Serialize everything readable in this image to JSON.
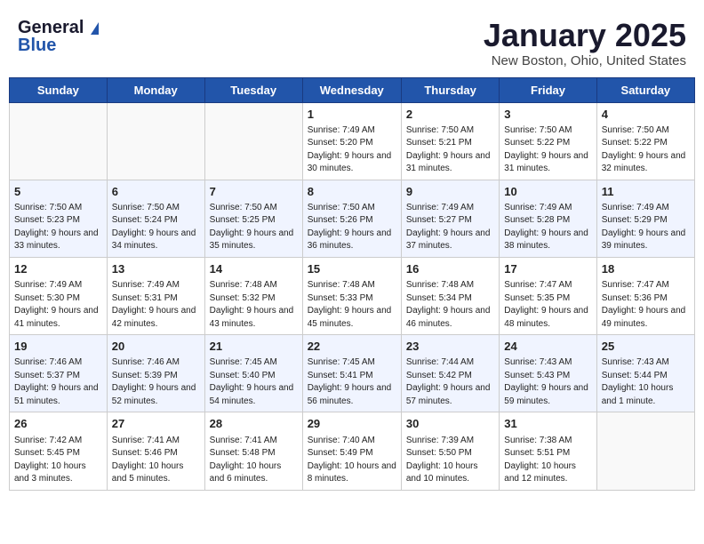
{
  "header": {
    "logo_line1": "General",
    "logo_line2": "Blue",
    "month": "January 2025",
    "location": "New Boston, Ohio, United States"
  },
  "weekdays": [
    "Sunday",
    "Monday",
    "Tuesday",
    "Wednesday",
    "Thursday",
    "Friday",
    "Saturday"
  ],
  "weeks": [
    [
      {
        "day": "",
        "sunrise": "",
        "sunset": "",
        "daylight": ""
      },
      {
        "day": "",
        "sunrise": "",
        "sunset": "",
        "daylight": ""
      },
      {
        "day": "",
        "sunrise": "",
        "sunset": "",
        "daylight": ""
      },
      {
        "day": "1",
        "sunrise": "Sunrise: 7:49 AM",
        "sunset": "Sunset: 5:20 PM",
        "daylight": "Daylight: 9 hours and 30 minutes."
      },
      {
        "day": "2",
        "sunrise": "Sunrise: 7:50 AM",
        "sunset": "Sunset: 5:21 PM",
        "daylight": "Daylight: 9 hours and 31 minutes."
      },
      {
        "day": "3",
        "sunrise": "Sunrise: 7:50 AM",
        "sunset": "Sunset: 5:22 PM",
        "daylight": "Daylight: 9 hours and 31 minutes."
      },
      {
        "day": "4",
        "sunrise": "Sunrise: 7:50 AM",
        "sunset": "Sunset: 5:22 PM",
        "daylight": "Daylight: 9 hours and 32 minutes."
      }
    ],
    [
      {
        "day": "5",
        "sunrise": "Sunrise: 7:50 AM",
        "sunset": "Sunset: 5:23 PM",
        "daylight": "Daylight: 9 hours and 33 minutes."
      },
      {
        "day": "6",
        "sunrise": "Sunrise: 7:50 AM",
        "sunset": "Sunset: 5:24 PM",
        "daylight": "Daylight: 9 hours and 34 minutes."
      },
      {
        "day": "7",
        "sunrise": "Sunrise: 7:50 AM",
        "sunset": "Sunset: 5:25 PM",
        "daylight": "Daylight: 9 hours and 35 minutes."
      },
      {
        "day": "8",
        "sunrise": "Sunrise: 7:50 AM",
        "sunset": "Sunset: 5:26 PM",
        "daylight": "Daylight: 9 hours and 36 minutes."
      },
      {
        "day": "9",
        "sunrise": "Sunrise: 7:49 AM",
        "sunset": "Sunset: 5:27 PM",
        "daylight": "Daylight: 9 hours and 37 minutes."
      },
      {
        "day": "10",
        "sunrise": "Sunrise: 7:49 AM",
        "sunset": "Sunset: 5:28 PM",
        "daylight": "Daylight: 9 hours and 38 minutes."
      },
      {
        "day": "11",
        "sunrise": "Sunrise: 7:49 AM",
        "sunset": "Sunset: 5:29 PM",
        "daylight": "Daylight: 9 hours and 39 minutes."
      }
    ],
    [
      {
        "day": "12",
        "sunrise": "Sunrise: 7:49 AM",
        "sunset": "Sunset: 5:30 PM",
        "daylight": "Daylight: 9 hours and 41 minutes."
      },
      {
        "day": "13",
        "sunrise": "Sunrise: 7:49 AM",
        "sunset": "Sunset: 5:31 PM",
        "daylight": "Daylight: 9 hours and 42 minutes."
      },
      {
        "day": "14",
        "sunrise": "Sunrise: 7:48 AM",
        "sunset": "Sunset: 5:32 PM",
        "daylight": "Daylight: 9 hours and 43 minutes."
      },
      {
        "day": "15",
        "sunrise": "Sunrise: 7:48 AM",
        "sunset": "Sunset: 5:33 PM",
        "daylight": "Daylight: 9 hours and 45 minutes."
      },
      {
        "day": "16",
        "sunrise": "Sunrise: 7:48 AM",
        "sunset": "Sunset: 5:34 PM",
        "daylight": "Daylight: 9 hours and 46 minutes."
      },
      {
        "day": "17",
        "sunrise": "Sunrise: 7:47 AM",
        "sunset": "Sunset: 5:35 PM",
        "daylight": "Daylight: 9 hours and 48 minutes."
      },
      {
        "day": "18",
        "sunrise": "Sunrise: 7:47 AM",
        "sunset": "Sunset: 5:36 PM",
        "daylight": "Daylight: 9 hours and 49 minutes."
      }
    ],
    [
      {
        "day": "19",
        "sunrise": "Sunrise: 7:46 AM",
        "sunset": "Sunset: 5:37 PM",
        "daylight": "Daylight: 9 hours and 51 minutes."
      },
      {
        "day": "20",
        "sunrise": "Sunrise: 7:46 AM",
        "sunset": "Sunset: 5:39 PM",
        "daylight": "Daylight: 9 hours and 52 minutes."
      },
      {
        "day": "21",
        "sunrise": "Sunrise: 7:45 AM",
        "sunset": "Sunset: 5:40 PM",
        "daylight": "Daylight: 9 hours and 54 minutes."
      },
      {
        "day": "22",
        "sunrise": "Sunrise: 7:45 AM",
        "sunset": "Sunset: 5:41 PM",
        "daylight": "Daylight: 9 hours and 56 minutes."
      },
      {
        "day": "23",
        "sunrise": "Sunrise: 7:44 AM",
        "sunset": "Sunset: 5:42 PM",
        "daylight": "Daylight: 9 hours and 57 minutes."
      },
      {
        "day": "24",
        "sunrise": "Sunrise: 7:43 AM",
        "sunset": "Sunset: 5:43 PM",
        "daylight": "Daylight: 9 hours and 59 minutes."
      },
      {
        "day": "25",
        "sunrise": "Sunrise: 7:43 AM",
        "sunset": "Sunset: 5:44 PM",
        "daylight": "Daylight: 10 hours and 1 minute."
      }
    ],
    [
      {
        "day": "26",
        "sunrise": "Sunrise: 7:42 AM",
        "sunset": "Sunset: 5:45 PM",
        "daylight": "Daylight: 10 hours and 3 minutes."
      },
      {
        "day": "27",
        "sunrise": "Sunrise: 7:41 AM",
        "sunset": "Sunset: 5:46 PM",
        "daylight": "Daylight: 10 hours and 5 minutes."
      },
      {
        "day": "28",
        "sunrise": "Sunrise: 7:41 AM",
        "sunset": "Sunset: 5:48 PM",
        "daylight": "Daylight: 10 hours and 6 minutes."
      },
      {
        "day": "29",
        "sunrise": "Sunrise: 7:40 AM",
        "sunset": "Sunset: 5:49 PM",
        "daylight": "Daylight: 10 hours and 8 minutes."
      },
      {
        "day": "30",
        "sunrise": "Sunrise: 7:39 AM",
        "sunset": "Sunset: 5:50 PM",
        "daylight": "Daylight: 10 hours and 10 minutes."
      },
      {
        "day": "31",
        "sunrise": "Sunrise: 7:38 AM",
        "sunset": "Sunset: 5:51 PM",
        "daylight": "Daylight: 10 hours and 12 minutes."
      },
      {
        "day": "",
        "sunrise": "",
        "sunset": "",
        "daylight": ""
      }
    ]
  ]
}
